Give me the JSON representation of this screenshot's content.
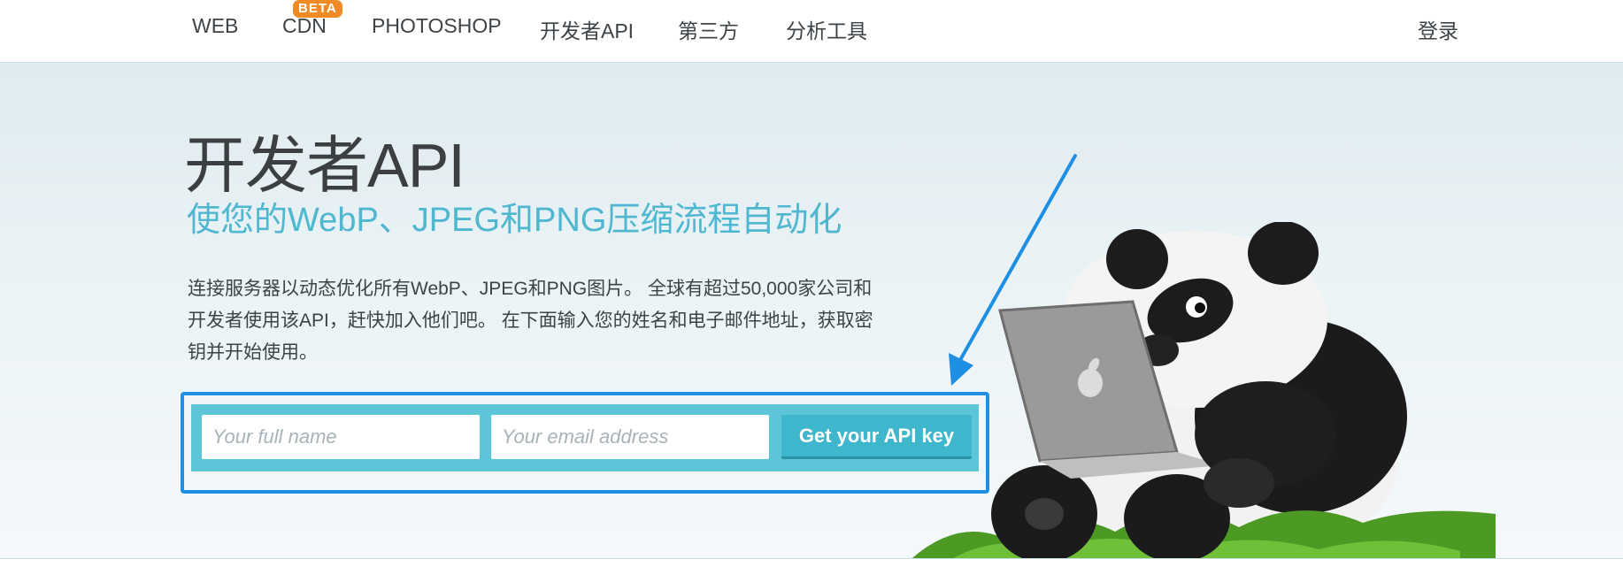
{
  "nav": {
    "items": [
      {
        "label": "WEB"
      },
      {
        "label": "CDN",
        "badge": "BETA"
      },
      {
        "label": "PHOTOSHOP"
      },
      {
        "label": "开发者API"
      },
      {
        "label": "第三方"
      },
      {
        "label": "分析工具"
      }
    ],
    "login": "登录"
  },
  "hero": {
    "title": "开发者API",
    "subtitle": "使您的WebP、JPEG和PNG压缩流程自动化",
    "description": "连接服务器以动态优化所有WebP、JPEG和PNG图片。 全球有超过50,000家公司和开发者使用该API，赶快加入他们吧。 在下面输入您的姓名和电子邮件地址，获取密钥并开始使用。"
  },
  "form": {
    "name_placeholder": "Your full name",
    "email_placeholder": "Your email address",
    "button_label": "Get your API key"
  },
  "colors": {
    "accent": "#5cc6d8",
    "subtitle": "#4fb7cf",
    "highlight_box": "#1f8fe3",
    "badge": "#f08a24"
  },
  "icons": [
    "panda-illustration",
    "laptop-icon",
    "apple-logo-icon",
    "arrow-annotation-icon"
  ]
}
